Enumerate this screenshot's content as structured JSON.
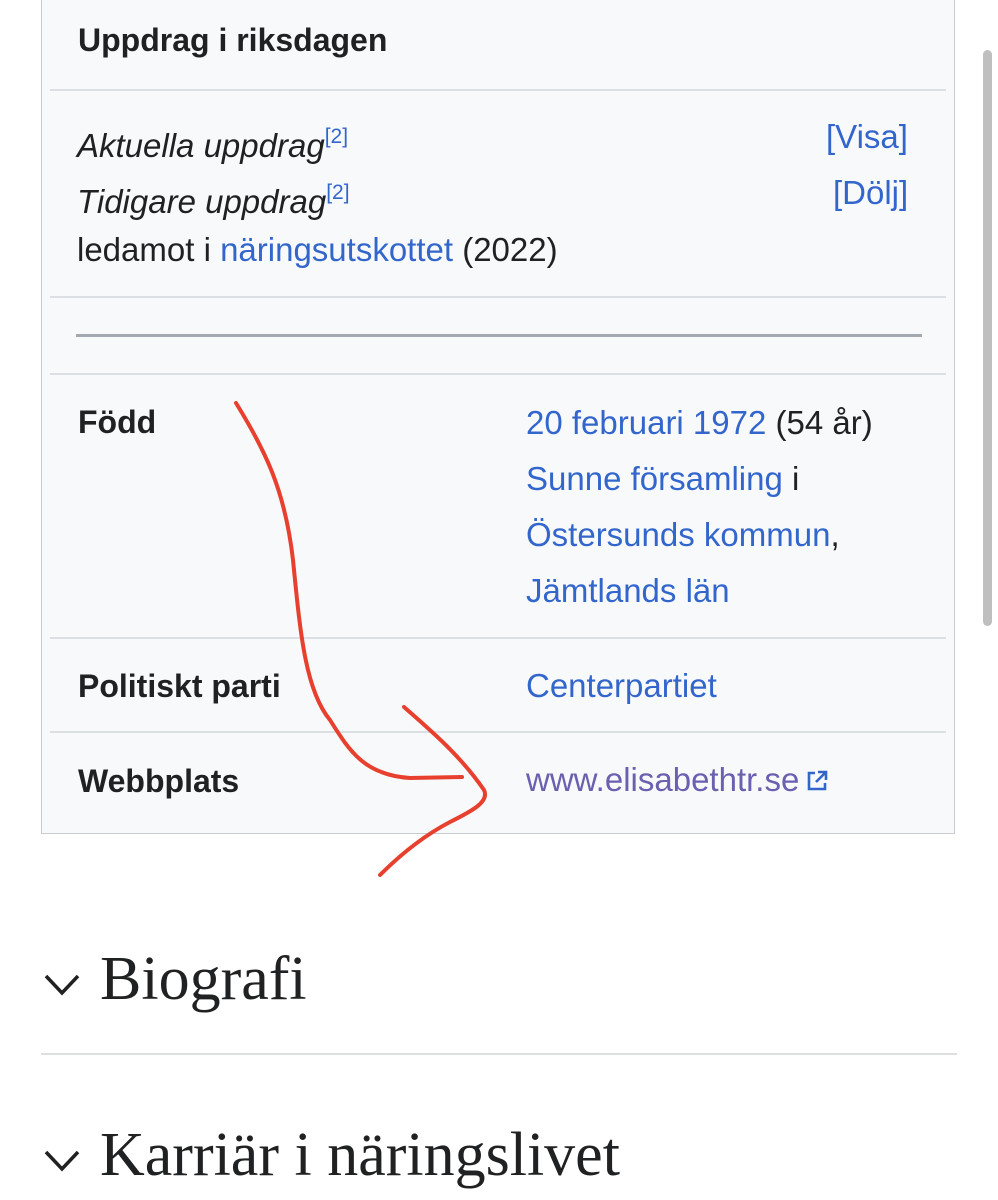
{
  "infobox": {
    "section_heading": "Uppdrag i riksdagen",
    "current_label": "Aktuella uppdrag",
    "current_ref": "[2]",
    "current_toggle": "[Visa]",
    "past_label": "Tidigare uppdrag",
    "past_ref": "[2]",
    "past_toggle": "[Dölj]",
    "member_prefix": "ledamot i ",
    "member_committee": "näringsutskottet",
    "member_year": " (2022)",
    "born_label": "Född",
    "born_date": "20 februari 1972",
    "born_age": " (54 år)",
    "born_parish": "Sunne församling",
    "born_parish_suffix": " i",
    "born_municipality": "Östersunds kommun",
    "born_municipality_suffix": ",",
    "born_county": "Jämtlands län",
    "party_label": "Politiskt parti",
    "party_value": "Centerpartiet",
    "website_label": "Webbplats",
    "website_value": "www.elisabethtr.se",
    "website_icon": "external-link-icon"
  },
  "sections": [
    {
      "title": "Biografi",
      "icon": "chevron-down-icon"
    },
    {
      "title": "Karriär i näringslivet",
      "icon": "chevron-down-icon"
    }
  ],
  "colors": {
    "link": "#3366cc",
    "visited_link": "#6a60b0",
    "annotation": "#e8402e",
    "infobox_bg": "#f8f9fa"
  }
}
